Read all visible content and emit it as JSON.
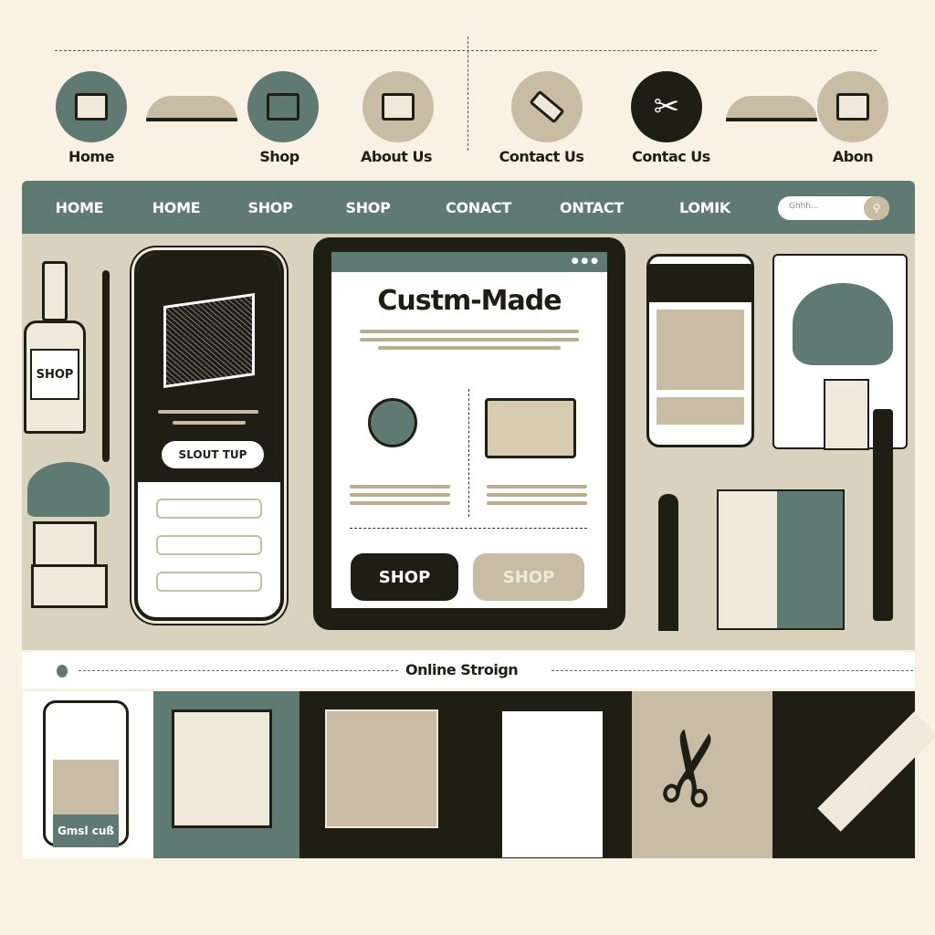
{
  "colors": {
    "background": "#f8f1e4",
    "teal": "#5e7a72",
    "dark": "#1e1e14",
    "beige": "#c8bca4",
    "panel": "#d8d2bf"
  },
  "top_nav": [
    {
      "label": "Home",
      "icon": "picture-frame-icon",
      "color": "#5e7a72"
    },
    {
      "label": "Shop",
      "icon": "house-icon",
      "color": "#5e7a72"
    },
    {
      "label": "About Us",
      "icon": "laptop-icon",
      "color": "#c8bca4"
    },
    {
      "label": "Contact Us",
      "icon": "ruler-icon",
      "color": "#c8bca4"
    },
    {
      "label": "Contac Us",
      "icon": "scissors-icon",
      "color": "#1e1e14"
    },
    {
      "label": "Abon",
      "icon": "document-icon",
      "color": "#c8bca4"
    }
  ],
  "nav_bar": {
    "items": [
      "HOME",
      "HOME",
      "SHOP",
      "SHOP",
      "CONACT",
      "ONTACT",
      "LOMIK"
    ],
    "search_placeholder": "Ghhh..."
  },
  "left": {
    "bottle_label": "SHOP"
  },
  "phone": {
    "cta": "SLOUT TUP"
  },
  "tablet": {
    "title": "Custm-Made",
    "buttons": [
      "SHOP",
      "SHOP"
    ]
  },
  "section_title": "Online Stroign",
  "bottom_phone": {
    "button": "Gmsl cuß"
  }
}
